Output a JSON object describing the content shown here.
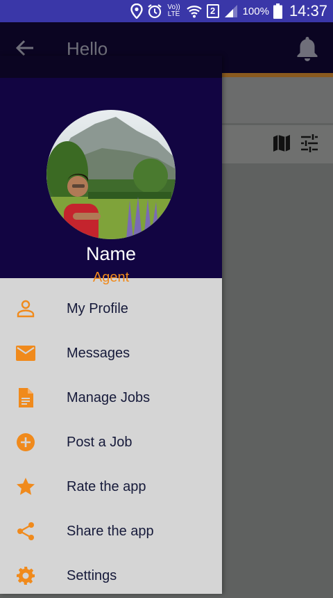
{
  "status_bar": {
    "network_label": "Vo)) LTE",
    "sim_badge": "2",
    "battery": "100%",
    "time": "14:37"
  },
  "app_bar": {
    "title": "Hello",
    "icons": [
      "back-arrow-icon",
      "notification-bell-icon"
    ]
  },
  "toolbar": {
    "icons": [
      "map-icon",
      "tune-icon"
    ]
  },
  "drawer": {
    "user": {
      "name": "Name",
      "role": "Agent"
    },
    "items": [
      {
        "label": "My Profile",
        "icon": "person-icon"
      },
      {
        "label": "Messages",
        "icon": "mail-icon"
      },
      {
        "label": "Manage Jobs",
        "icon": "document-icon"
      },
      {
        "label": "Post a Job",
        "icon": "add-circle-icon"
      },
      {
        "label": "Rate the app",
        "icon": "star-icon"
      },
      {
        "label": "Share the app",
        "icon": "share-icon"
      },
      {
        "label": "Settings",
        "icon": "gear-icon"
      }
    ]
  },
  "colors": {
    "accent": "#f08a1c",
    "header": "#120542",
    "status_bar": "#3a37a8"
  }
}
